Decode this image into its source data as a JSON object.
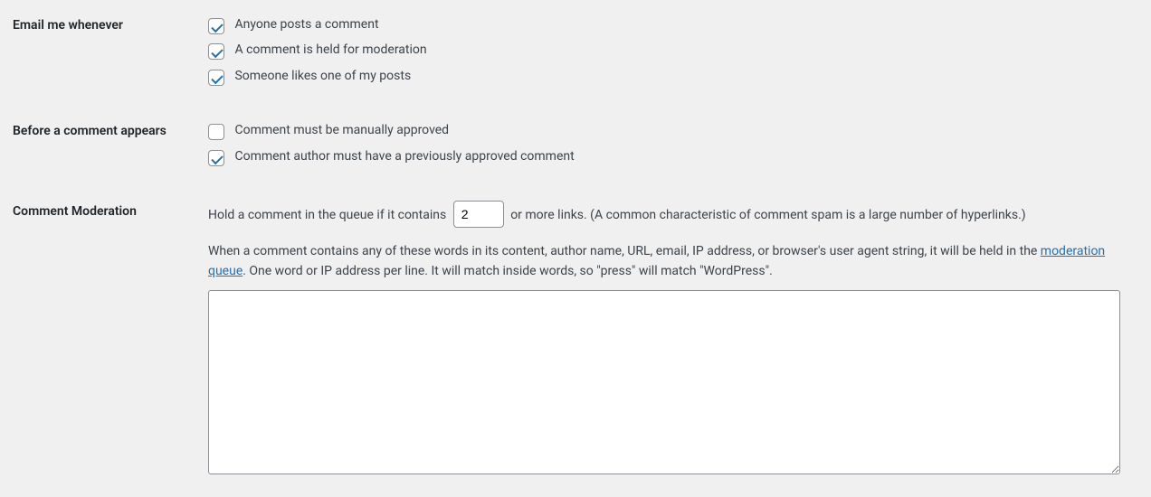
{
  "email_me": {
    "heading": "Email me whenever",
    "options": [
      {
        "label": "Anyone posts a comment",
        "checked": true
      },
      {
        "label": "A comment is held for moderation",
        "checked": true
      },
      {
        "label": "Someone likes one of my posts",
        "checked": true
      }
    ]
  },
  "before_appears": {
    "heading": "Before a comment appears",
    "options": [
      {
        "label": "Comment must be manually approved",
        "checked": false
      },
      {
        "label": "Comment author must have a previously approved comment",
        "checked": true
      }
    ]
  },
  "moderation": {
    "heading": "Comment Moderation",
    "hold_pre": "Hold a comment in the queue if it contains",
    "max_links": "2",
    "hold_post": "or more links. (A common characteristic of comment spam is a large number of hyperlinks.)",
    "desc_pre": "When a comment contains any of these words in its content, author name, URL, email, IP address, or browser's user agent string, it will be held in the ",
    "desc_link": "moderation queue",
    "desc_post": ". One word or IP address per line. It will match inside words, so \"press\" will match \"WordPress\".",
    "textarea_value": ""
  }
}
